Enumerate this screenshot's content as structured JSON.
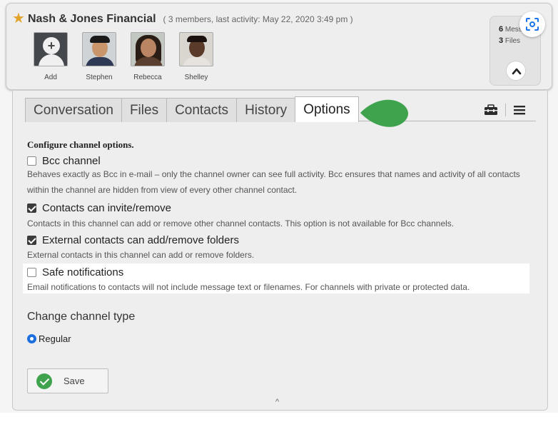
{
  "header": {
    "title": "Nash & Jones Financial",
    "meta": "( 3 members, last activity: May 22, 2020 3:49 pm )",
    "members": [
      {
        "name": "Add"
      },
      {
        "name": "Stephen"
      },
      {
        "name": "Rebecca"
      },
      {
        "name": "Shelley"
      }
    ],
    "stats": {
      "messages_count": "6",
      "messages_label": "Messages",
      "files_count": "3",
      "files_label": "Files"
    }
  },
  "tabs": [
    {
      "label": "Conversation"
    },
    {
      "label": "Files"
    },
    {
      "label": "Contacts"
    },
    {
      "label": "History"
    },
    {
      "label": "Options",
      "active": true
    }
  ],
  "options": {
    "section_title": "Configure channel options.",
    "items": [
      {
        "label": "Bcc channel",
        "checked": false,
        "desc": "Behaves exactly as Bcc in e-mail – only the channel owner can see full activity. Bcc ensures that names and activity of all contacts within the channel are hidden from view of every other channel contact."
      },
      {
        "label": "Contacts can invite/remove",
        "checked": true,
        "desc": "Contacts in this channel can add or remove other channel contacts. This option is not available for Bcc channels."
      },
      {
        "label": "External contacts can add/remove folders",
        "checked": true,
        "desc": "External contacts in this channel can add or remove folders."
      },
      {
        "label": "Safe notifications",
        "checked": false,
        "desc": "Email notifications to contacts will not include message text or filenames. For channels with private or protected data."
      }
    ]
  },
  "channel_type": {
    "title": "Change channel type",
    "selected": "Regular"
  },
  "save_label": "Save",
  "colors": {
    "accent_green": "#3fa34d",
    "pointer_green": "#3fa34d",
    "radio_blue": "#1d6fe0",
    "star": "#e1a32a"
  },
  "icons": [
    "star-icon",
    "add-person-icon",
    "chevron-up-icon",
    "scan-icon",
    "toolbox-icon",
    "menu-icon",
    "checkmark-icon",
    "caret-up-icon"
  ]
}
